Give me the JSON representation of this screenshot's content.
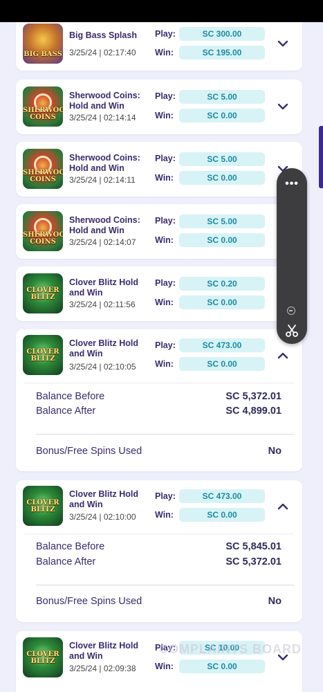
{
  "rows": [
    {
      "name": "Big Bass Splash",
      "thumb_label": "BIG BASS",
      "date": "3/25/24 | 02:17:40",
      "play_label": "Play:",
      "win_label": "Win:",
      "play": "SC 300.00",
      "win": "SC 195.00",
      "chevron": "chevron-down-icon"
    },
    {
      "name": "Sherwood Coins: Hold and Win",
      "thumb_label": "SHERWOOD COINS",
      "date": "3/25/24 | 02:14:14",
      "play_label": "Play:",
      "win_label": "Win:",
      "play": "SC 5.00",
      "win": "SC 0.00",
      "chevron": "chevron-down-icon"
    },
    {
      "name": "Sherwood Coins: Hold and Win",
      "thumb_label": "SHERWOOD COINS",
      "date": "3/25/24 | 02:14:11",
      "play_label": "Play:",
      "win_label": "Win:",
      "play": "SC 5.00",
      "win": "SC 0.00",
      "chevron": "chevron-down-icon"
    },
    {
      "name": "Sherwood Coins: Hold and Win",
      "thumb_label": "SHERWOOD COINS",
      "date": "3/25/24 | 02:14:07",
      "play_label": "Play:",
      "win_label": "Win:",
      "play": "SC 5.00",
      "win": "SC 0.00",
      "chevron": "chevron-down-icon"
    },
    {
      "name": "Clover Blitz Hold and Win",
      "thumb_label": "CLOVER BLITZ",
      "date": "3/25/24 | 02:11:56",
      "play_label": "Play:",
      "win_label": "Win:",
      "play": "SC 0.20",
      "win": "SC 0.00",
      "chevron": "chevron-down-icon"
    },
    {
      "name": "Clover Blitz Hold and Win",
      "thumb_label": "CLOVER BLITZ",
      "date": "3/25/24 | 02:10:05",
      "play_label": "Play:",
      "win_label": "Win:",
      "play": "SC 473.00",
      "win": "SC 0.00",
      "chevron": "chevron-up-icon",
      "details": {
        "balance_before_label": "Balance Before",
        "balance_before": "SC 5,372.01",
        "balance_after_label": "Balance After",
        "balance_after": "SC 4,899.01",
        "bonus_label": "Bonus/Free Spins Used",
        "bonus": "No"
      }
    },
    {
      "name": "Clover Blitz Hold and Win",
      "thumb_label": "CLOVER BLITZ",
      "date": "3/25/24 | 02:10:00",
      "play_label": "Play:",
      "win_label": "Win:",
      "play": "SC 473.00",
      "win": "SC 0.00",
      "chevron": "chevron-up-icon",
      "details": {
        "balance_before_label": "Balance Before",
        "balance_before": "SC 5,845.01",
        "balance_after_label": "Balance After",
        "balance_after": "SC 5,372.01",
        "bonus_label": "Bonus/Free Spins Used",
        "bonus": "No"
      }
    },
    {
      "name": "Clover Blitz Hold and Win",
      "thumb_label": "CLOVER BLITZ",
      "date": "3/25/24 | 02:09:38",
      "play_label": "Play:",
      "win_label": "Win:",
      "play": "SC 10.00",
      "win": "SC 0.00",
      "chevron": "chevron-down-icon"
    }
  ],
  "watermark": "COMPLAINTS BOARD",
  "floating_menu": {
    "icons": [
      "more-dots-icon",
      "zoom-out-icon",
      "scissors-icon"
    ]
  },
  "colors": {
    "accent": "#3a2a6e",
    "pill_bg": "#d7f3f6",
    "pill_text": "#1b8aa6",
    "page_bg": "#eeeffa"
  }
}
